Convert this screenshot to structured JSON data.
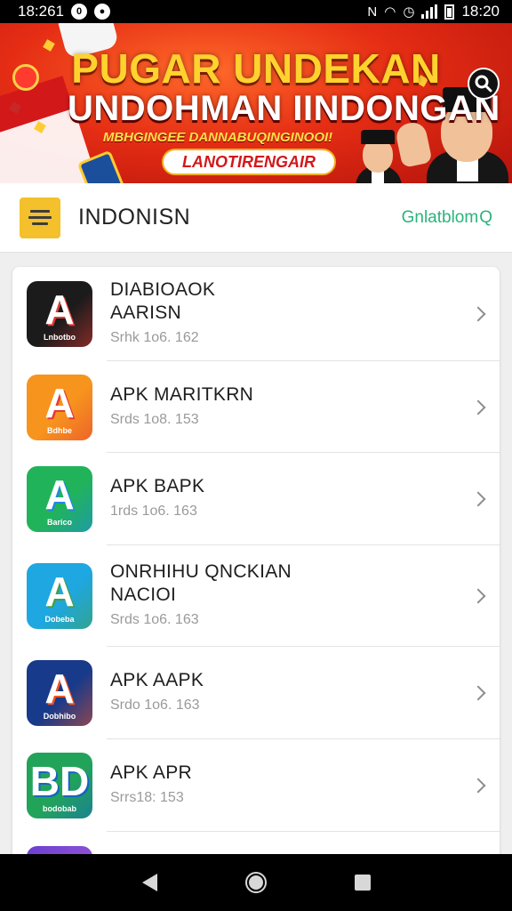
{
  "status_bar": {
    "time_left": "18:261",
    "time_right": "18:20"
  },
  "banner": {
    "title_line1": "PUGAR UNDEKAN",
    "title_line2": "UNDOHMAN IINDONGAN",
    "subtitle": "MBHGINGEE DANNABUQINGINOOI!",
    "cta": "LANOTIRENGAIR"
  },
  "header": {
    "title": "INDONISN",
    "link": "Gnlatblom",
    "menu_icon": "menu-icon"
  },
  "apps": [
    {
      "name": "DIABIOAOK\nAARISN",
      "meta": "Srhk 1o6. 162",
      "icon_color": "#1b1b1b",
      "icon_accent": "#e53935",
      "glyph": "A",
      "tag": "Lnbotbo"
    },
    {
      "name": "APK MARITKRN",
      "meta": "Srds 1o8. 153",
      "icon_color": "#f7941d",
      "icon_accent": "#e53935",
      "glyph": "A",
      "tag": "Bdhbe"
    },
    {
      "name": "APK BAPK",
      "meta": "1rds 1o6. 163",
      "icon_color": "#21b35a",
      "icon_accent": "#1e88e5",
      "glyph": "A",
      "tag": "Barico"
    },
    {
      "name": "ONRHIHU QNCKIAN\nNACIOI",
      "meta": "Srds 1o6. 163",
      "icon_color": "#1ea7e1",
      "icon_accent": "#43a047",
      "glyph": "A",
      "tag": "Dobeba"
    },
    {
      "name": "APK AAPK",
      "meta": "Srdo 1o6. 163",
      "icon_color": "#183a8a",
      "icon_accent": "#f4511e",
      "glyph": "A",
      "tag": "Dobhibo"
    },
    {
      "name": "APK APR",
      "meta": "Srrs18: 153",
      "icon_color": "#22a35a",
      "icon_accent": "#1565c0",
      "glyph": "BD",
      "tag": "bodobab"
    }
  ]
}
